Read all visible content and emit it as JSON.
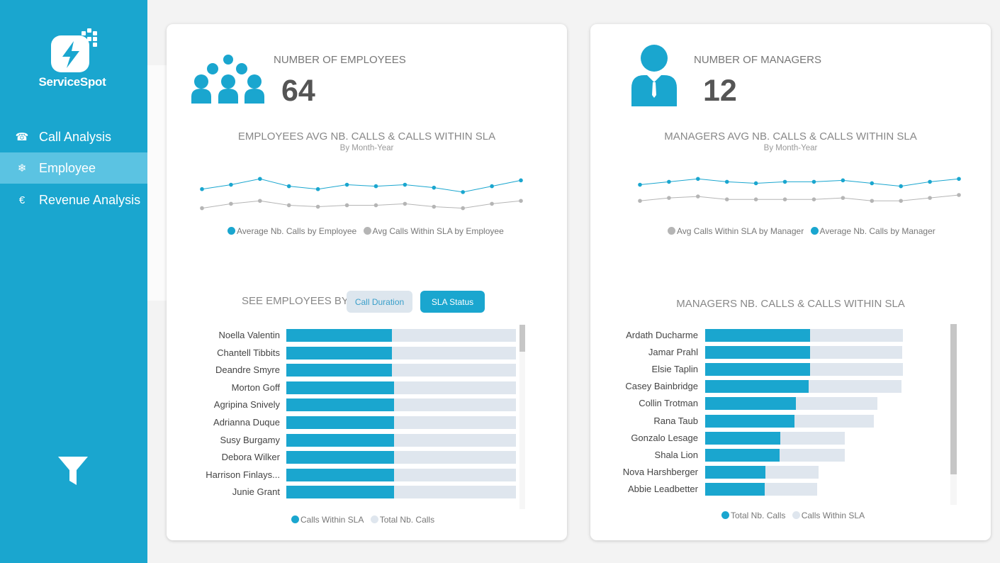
{
  "app": {
    "name": "ServiceSpot"
  },
  "colors": {
    "accent": "#1aa6cf",
    "accent_light": "#5bc3e2",
    "grey_series": "#b5b5b5",
    "bar_total": "#dfe6ee"
  },
  "nav": {
    "items": [
      {
        "label": "Call Analysis",
        "icon": "phone-icon",
        "glyph": "☎",
        "active": false
      },
      {
        "label": "Employee",
        "icon": "asterisk-icon",
        "glyph": "❄",
        "active": true
      },
      {
        "label": "Revenue Analysis",
        "icon": "euro-icon",
        "glyph": "€",
        "active": false
      }
    ],
    "filter_icon": "filter-icon"
  },
  "employees_card": {
    "kpi_label": "NUMBER OF EMPLOYEES",
    "kpi_value": "64",
    "kpi_icon": "group-icon",
    "line_title": "EMPLOYEES AVG NB. CALLS & CALLS WITHIN SLA",
    "line_subtitle": "By Month-Year",
    "legend": [
      "Average Nb. Calls by Employee",
      "Avg Calls Within SLA by Employee"
    ],
    "see_label": "SEE EMPLOYEES BY:",
    "buttons": {
      "duration": "Call Duration",
      "sla": "SLA Status"
    },
    "bar_legend": [
      "Calls Within SLA",
      "Total Nb. Calls"
    ]
  },
  "managers_card": {
    "kpi_label": "NUMBER OF MANAGERS",
    "kpi_value": "12",
    "kpi_icon": "manager-icon",
    "line_title": "MANAGERS AVG NB. CALLS & CALLS WITHIN SLA",
    "line_subtitle": "By Month-Year",
    "legend": [
      "Avg Calls Within SLA by Manager",
      "Average Nb. Calls by Manager"
    ],
    "bar_title": "MANAGERS NB. CALLS & CALLS WITHIN SLA",
    "bar_legend": [
      "Total Nb. Calls",
      "Calls Within SLA"
    ]
  },
  "chart_data": [
    {
      "id": "employees_line",
      "type": "line",
      "title": "EMPLOYEES AVG NB. CALLS & CALLS WITHIN SLA",
      "subtitle": "By Month-Year",
      "ylim": [
        0,
        100
      ],
      "series": [
        {
          "name": "Average Nb. Calls by Employee",
          "color": "#1aa6cf",
          "values": [
            74,
            77,
            81,
            76,
            74,
            77,
            76,
            77,
            75,
            72,
            76,
            80
          ]
        },
        {
          "name": "Avg Calls Within SLA by Employee",
          "color": "#b5b5b5",
          "values": [
            61,
            64,
            66,
            63,
            62,
            63,
            63,
            64,
            62,
            61,
            64,
            66
          ]
        }
      ]
    },
    {
      "id": "managers_line",
      "type": "line",
      "title": "MANAGERS AVG NB. CALLS & CALLS WITHIN SLA",
      "subtitle": "By Month-Year",
      "ylim": [
        0,
        100
      ],
      "series": [
        {
          "name": "Average Nb. Calls by Manager",
          "color": "#1aa6cf",
          "values": [
            77,
            79,
            81,
            79,
            78,
            79,
            79,
            80,
            78,
            76,
            79,
            81
          ]
        },
        {
          "name": "Avg Calls Within SLA by Manager",
          "color": "#b5b5b5",
          "values": [
            66,
            68,
            69,
            67,
            67,
            67,
            67,
            68,
            66,
            66,
            68,
            70
          ]
        }
      ]
    },
    {
      "id": "employees_bar",
      "type": "bar",
      "orientation": "horizontal",
      "categories": [
        "Noella Valentin",
        "Chantell Tibbits",
        "Deandre Smyre",
        "Morton Goff",
        "Agripina Snively",
        "Adrianna Duque",
        "Susy Burgamy",
        "Debora Wilker",
        "Harrison Finlays...",
        "Junie Grant"
      ],
      "xlim": [
        0,
        100
      ],
      "series": [
        {
          "name": "Calls Within SLA",
          "color": "#1aa6cf",
          "values": [
            46,
            46,
            46,
            47,
            47,
            47,
            47,
            47,
            47,
            47
          ]
        },
        {
          "name": "Total Nb. Calls",
          "color": "#dfe6ee",
          "values": [
            100,
            100,
            100,
            100,
            100,
            100,
            100,
            100,
            100,
            100
          ]
        }
      ]
    },
    {
      "id": "managers_bar",
      "type": "bar",
      "orientation": "horizontal",
      "title": "MANAGERS NB. CALLS & CALLS WITHIN SLA",
      "categories": [
        "Ardath Ducharme",
        "Jamar Prahl",
        "Elsie Taplin",
        "Casey Bainbridge",
        "Collin Trotman",
        "Rana Taub",
        "Gonzalo Lesage",
        "Shala Lion",
        "Nova Harshberger",
        "Abbie Leadbetter"
      ],
      "xlim": [
        0,
        100
      ],
      "series": [
        {
          "name": "Total Nb. Calls",
          "color": "#dfe6ee",
          "values": [
            100,
            99.6,
            100,
            99.3,
            87.1,
            85.3,
            70.7,
            70.7,
            57.2,
            56.8
          ]
        },
        {
          "name": "Calls Within SLA",
          "color": "#1aa6cf",
          "values": [
            53.2,
            53.2,
            53.2,
            52.5,
            46,
            45,
            38.1,
            37.8,
            30.6,
            30.2
          ]
        }
      ]
    }
  ]
}
